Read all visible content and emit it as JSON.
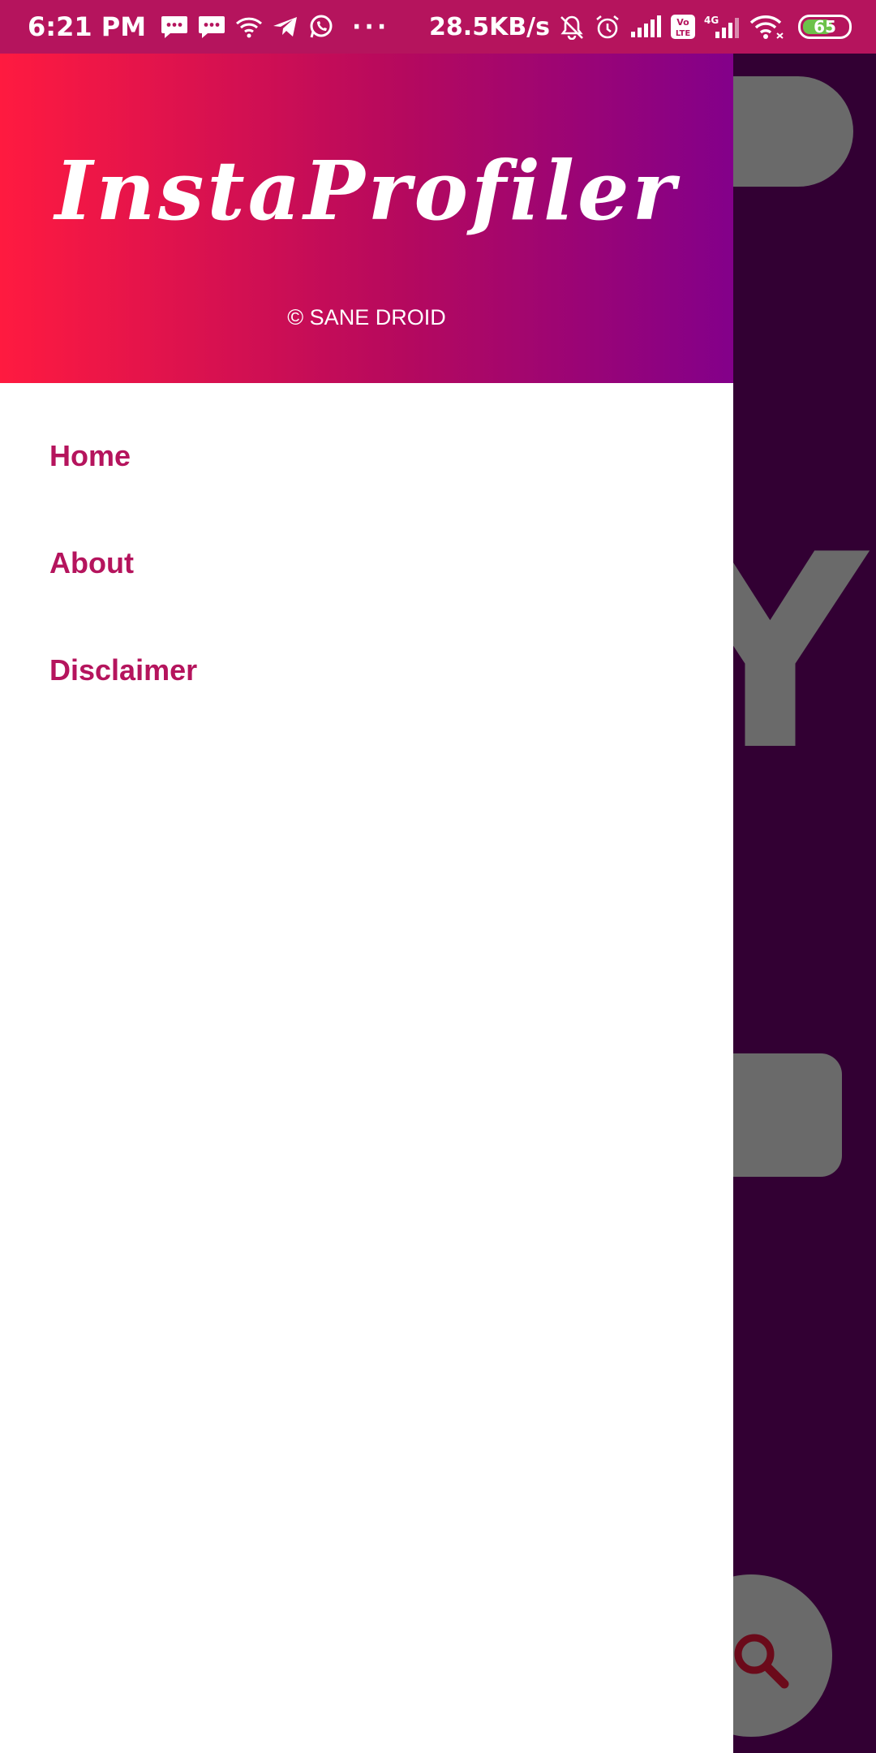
{
  "status_bar": {
    "time": "6:21 PM",
    "network_speed": "28.5KB/s",
    "overflow_dots": "···",
    "battery_level": "65",
    "icons": [
      "message-icon",
      "message-icon",
      "wifi-icon",
      "telegram-icon",
      "whatsapp-icon",
      "mute-icon",
      "alarm-icon",
      "signal-icon",
      "volte-icon",
      "signal-4g-icon",
      "wifi-icon",
      "battery-icon"
    ]
  },
  "drawer": {
    "header": {
      "app_name": "InstaProfiler",
      "copyright": "© SANE DROID"
    },
    "menu_items": [
      {
        "label": "Home"
      },
      {
        "label": "About"
      },
      {
        "label": "Disclaimer"
      }
    ]
  },
  "background": {
    "partial_letter": "Y",
    "fab_icon": "search-icon"
  },
  "colors": {
    "status_bar": "#b5145d",
    "header_gradient_start": "#ff1a40",
    "header_gradient_end": "#83008a",
    "menu_text": "#b5145d",
    "background_dim": "#320033",
    "background_element": "#6a6a6a"
  }
}
